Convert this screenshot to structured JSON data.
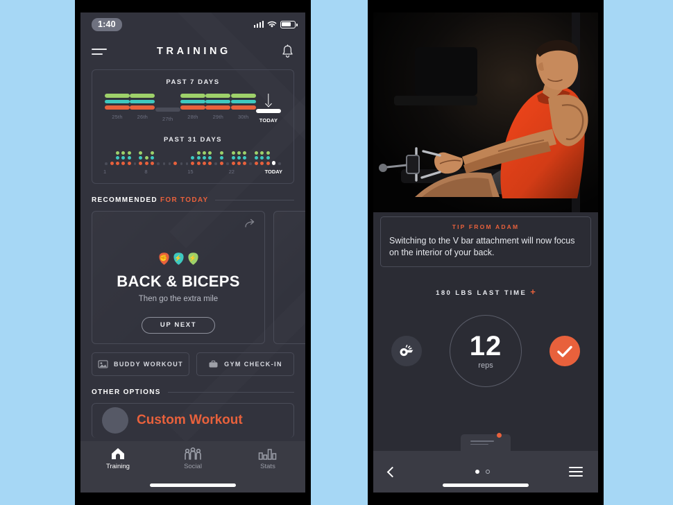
{
  "left_phone": {
    "status_bar": {
      "time": "1:40",
      "signal_icon": "cellular-bars-icon",
      "wifi_icon": "wifi-icon",
      "battery_icon": "battery-icon"
    },
    "header": {
      "menu_icon": "hamburger-menu-icon",
      "title": "TRAINING",
      "bell_icon": "notification-bell-icon"
    },
    "stats": {
      "week_title": "PAST 7 DAYS",
      "month_title": "PAST 31 DAYS",
      "week_days": [
        {
          "label": "25th",
          "bars": [
            "green",
            "teal",
            "orange"
          ]
        },
        {
          "label": "26th",
          "bars": [
            "green",
            "teal",
            "orange"
          ]
        },
        {
          "label": "27th",
          "bars": [
            "empty"
          ]
        },
        {
          "label": "28th",
          "bars": [
            "green",
            "teal",
            "orange"
          ]
        },
        {
          "label": "29th",
          "bars": [
            "green",
            "teal",
            "orange"
          ]
        },
        {
          "label": "30th",
          "bars": [
            "green",
            "teal",
            "orange"
          ]
        },
        {
          "label": "TODAY",
          "bars": [
            "today"
          ]
        }
      ],
      "month_labels": [
        "1",
        "8",
        "15",
        "22",
        "TODAY"
      ],
      "month_days": [
        [],
        [
          "o"
        ],
        [
          "g",
          "t",
          "o"
        ],
        [
          "g",
          "t",
          "o"
        ],
        [
          "g",
          "t",
          "o"
        ],
        [],
        [
          "g",
          "t",
          "o"
        ],
        [
          "g",
          "o"
        ],
        [
          "g",
          "t",
          "o"
        ],
        [],
        [],
        [],
        [
          "o"
        ],
        [],
        [],
        [
          "t",
          "o"
        ],
        [
          "g",
          "t",
          "o"
        ],
        [
          "g",
          "t",
          "o"
        ],
        [
          "g",
          "t",
          "o"
        ],
        [],
        [
          "g",
          "t",
          "o"
        ],
        [],
        [
          "g",
          "t",
          "o"
        ],
        [
          "g",
          "t",
          "o"
        ],
        [
          "g",
          "t",
          "o"
        ],
        [],
        [
          "g",
          "t",
          "o"
        ],
        [
          "g",
          "t",
          "o"
        ],
        [
          "g",
          "t",
          "o"
        ],
        [
          "today"
        ],
        []
      ],
      "colors": {
        "green": "#9ed16a",
        "teal": "#3ec9c0",
        "orange": "#e8613c",
        "empty": "#4a4c58",
        "today": "#ffffff"
      }
    },
    "recommended": {
      "heading": "RECOMMENDED",
      "heading_accent": "FOR TODAY",
      "card": {
        "share_icon": "share-arrow-icon",
        "badges": [
          {
            "name": "strength-badge",
            "color": "#e8613c",
            "glyph": "fist-icon"
          },
          {
            "name": "energy-badge",
            "color": "#3ec9c0",
            "glyph": "lightning-icon"
          },
          {
            "name": "power-badge",
            "color": "#9ed16a",
            "glyph": "lightning-icon"
          }
        ],
        "title": "BACK & BICEPS",
        "subtitle": "Then go the extra mile",
        "button": "UP NEXT"
      }
    },
    "actions": [
      {
        "name": "buddy-workout-button",
        "label": "BUDDY WORKOUT",
        "icon": "people-photo-icon"
      },
      {
        "name": "gym-check-in-button",
        "label": "GYM CHECK-IN",
        "icon": "gym-bag-icon"
      }
    ],
    "other_options": {
      "heading": "OTHER OPTIONS",
      "item_title": "Custom Workout"
    },
    "tabs": [
      {
        "name": "tab-training",
        "label": "Training",
        "icon": "home-icon",
        "active": true
      },
      {
        "name": "tab-social",
        "label": "Social",
        "icon": "people-icon",
        "active": false
      },
      {
        "name": "tab-stats",
        "label": "Stats",
        "icon": "bar-chart-icon",
        "active": false
      }
    ]
  },
  "right_phone": {
    "hero": {
      "alt": "athlete-performing-seated-cable-row"
    },
    "tip": {
      "heading": "TIP FROM ADAM",
      "body": "Switching to the V bar attachment will now focus on the interior of your back."
    },
    "last_time": {
      "text": "180 LBS LAST TIME",
      "plus": "+"
    },
    "reps": {
      "value": "12",
      "unit": "reps"
    },
    "buttons": [
      {
        "name": "whistle-button",
        "icon": "whistle-icon"
      },
      {
        "name": "complete-set-button",
        "icon": "checkmark-icon"
      }
    ],
    "nav": {
      "back_icon": "chevron-left-icon",
      "menu_icon": "hamburger-menu-icon",
      "pages": [
        {
          "active": true
        },
        {
          "active": false
        }
      ]
    },
    "accent_color": "#e8613c"
  }
}
